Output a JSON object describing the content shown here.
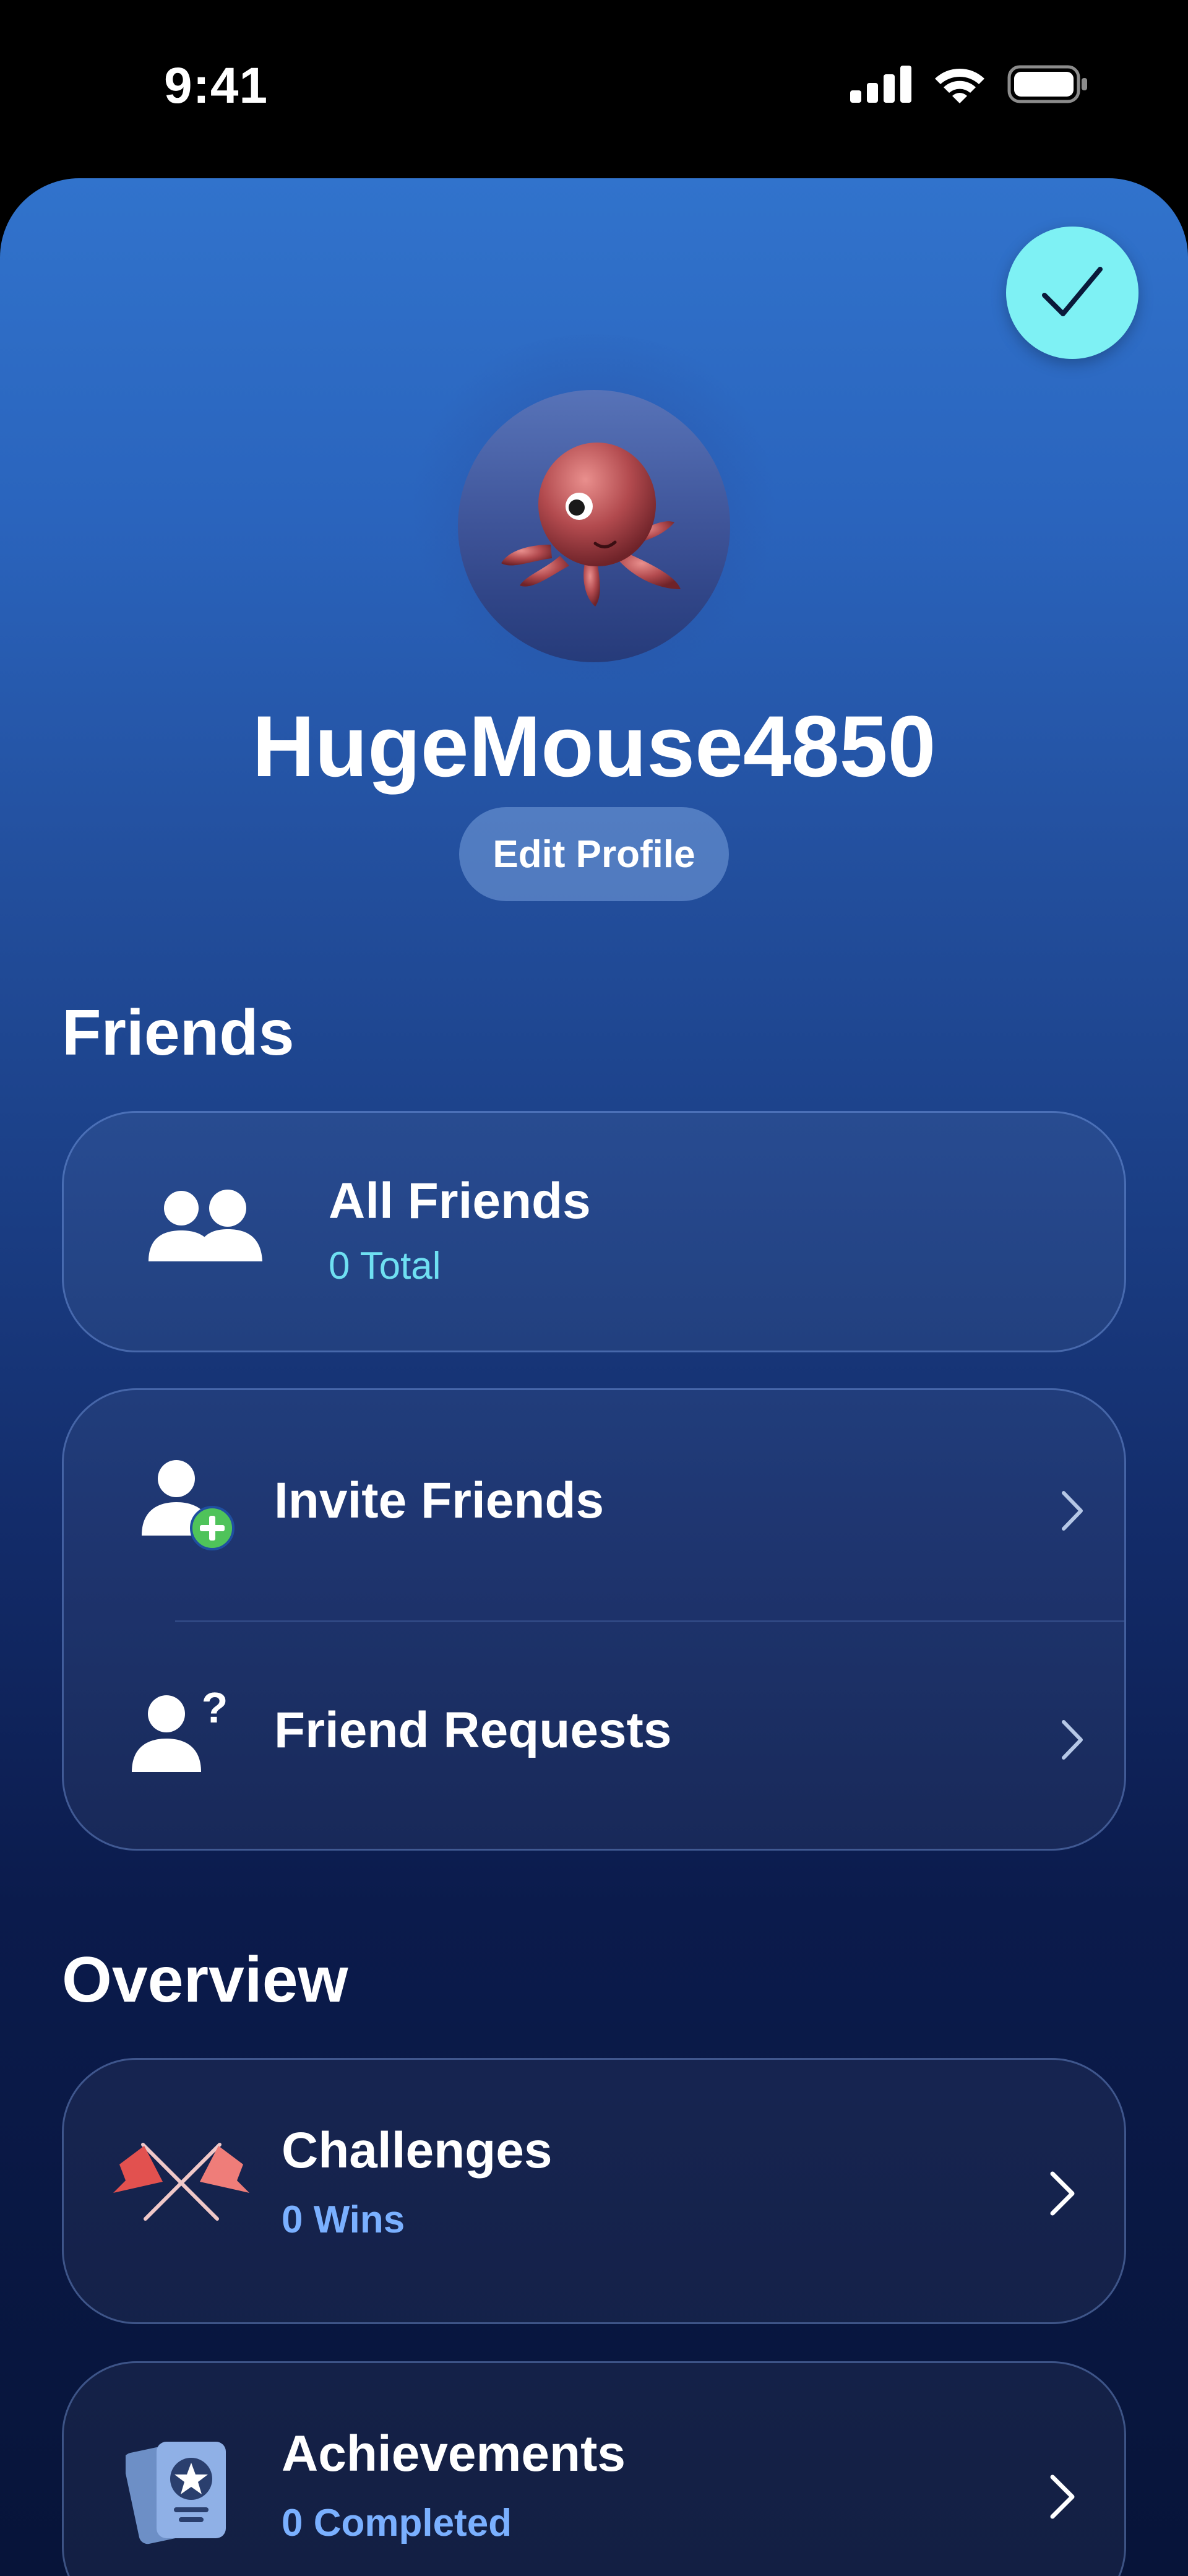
{
  "status_bar": {
    "time": "9:41"
  },
  "profile": {
    "username": "HugeMouse4850",
    "edit_label": "Edit Profile"
  },
  "friends": {
    "title": "Friends",
    "all_friends_label": "All Friends",
    "all_friends_count": "0 Total",
    "invite_label": "Invite Friends",
    "requests_label": "Friend Requests"
  },
  "overview": {
    "title": "Overview",
    "challenges_label": "Challenges",
    "challenges_sub": "0 Wins",
    "achievements_label": "Achievements",
    "achievements_sub": "0 Completed"
  },
  "colors": {
    "accent_cyan": "#7ef1f4",
    "sub_cyan": "#6fe0f2",
    "sub_blue": "#7ab0ff"
  }
}
